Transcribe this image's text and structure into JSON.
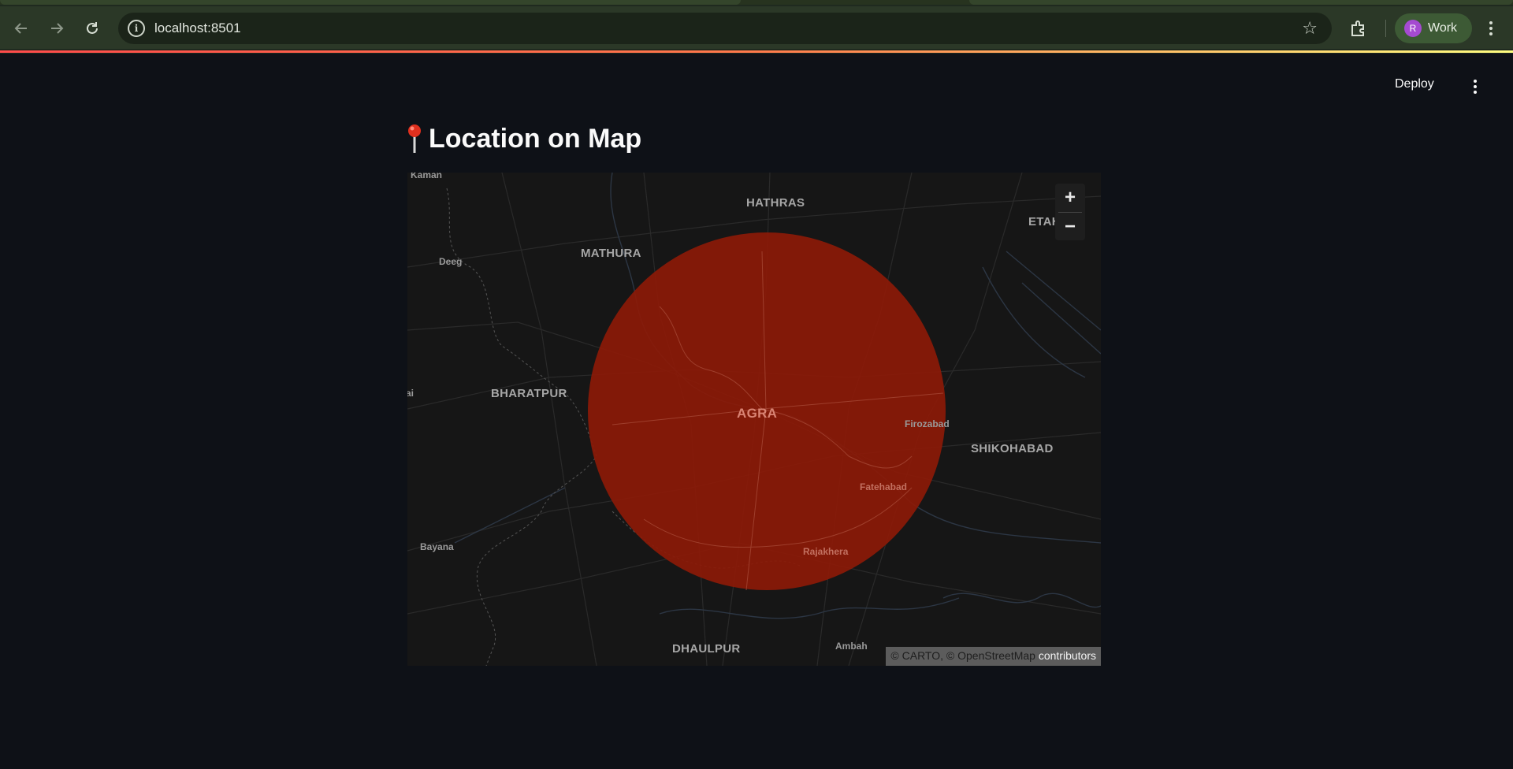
{
  "browser": {
    "url": "localhost:8501",
    "profile_initial": "R",
    "profile_name": "Work"
  },
  "app": {
    "deploy_label": "Deploy",
    "title": "Location on Map"
  },
  "map": {
    "center_city": "AGRA",
    "circle_color": "#8b1a07",
    "cities": [
      "HATHRAS",
      "MATHURA",
      "ETAH",
      "BHARATPUR",
      "SHIKOHABAD",
      "DHAULPUR"
    ],
    "towns": [
      "Kaman",
      "Deeg",
      "Bayana",
      "Firozabad",
      "Fatehabad",
      "Rajakhera",
      "Ambah"
    ],
    "edge_label": "ai",
    "zoom_in": "+",
    "zoom_out": "−",
    "attribution": {
      "carto": "© CARTO",
      "sep": ", ",
      "osm": "© OpenStreetMap",
      "contributors": " contributors"
    }
  }
}
